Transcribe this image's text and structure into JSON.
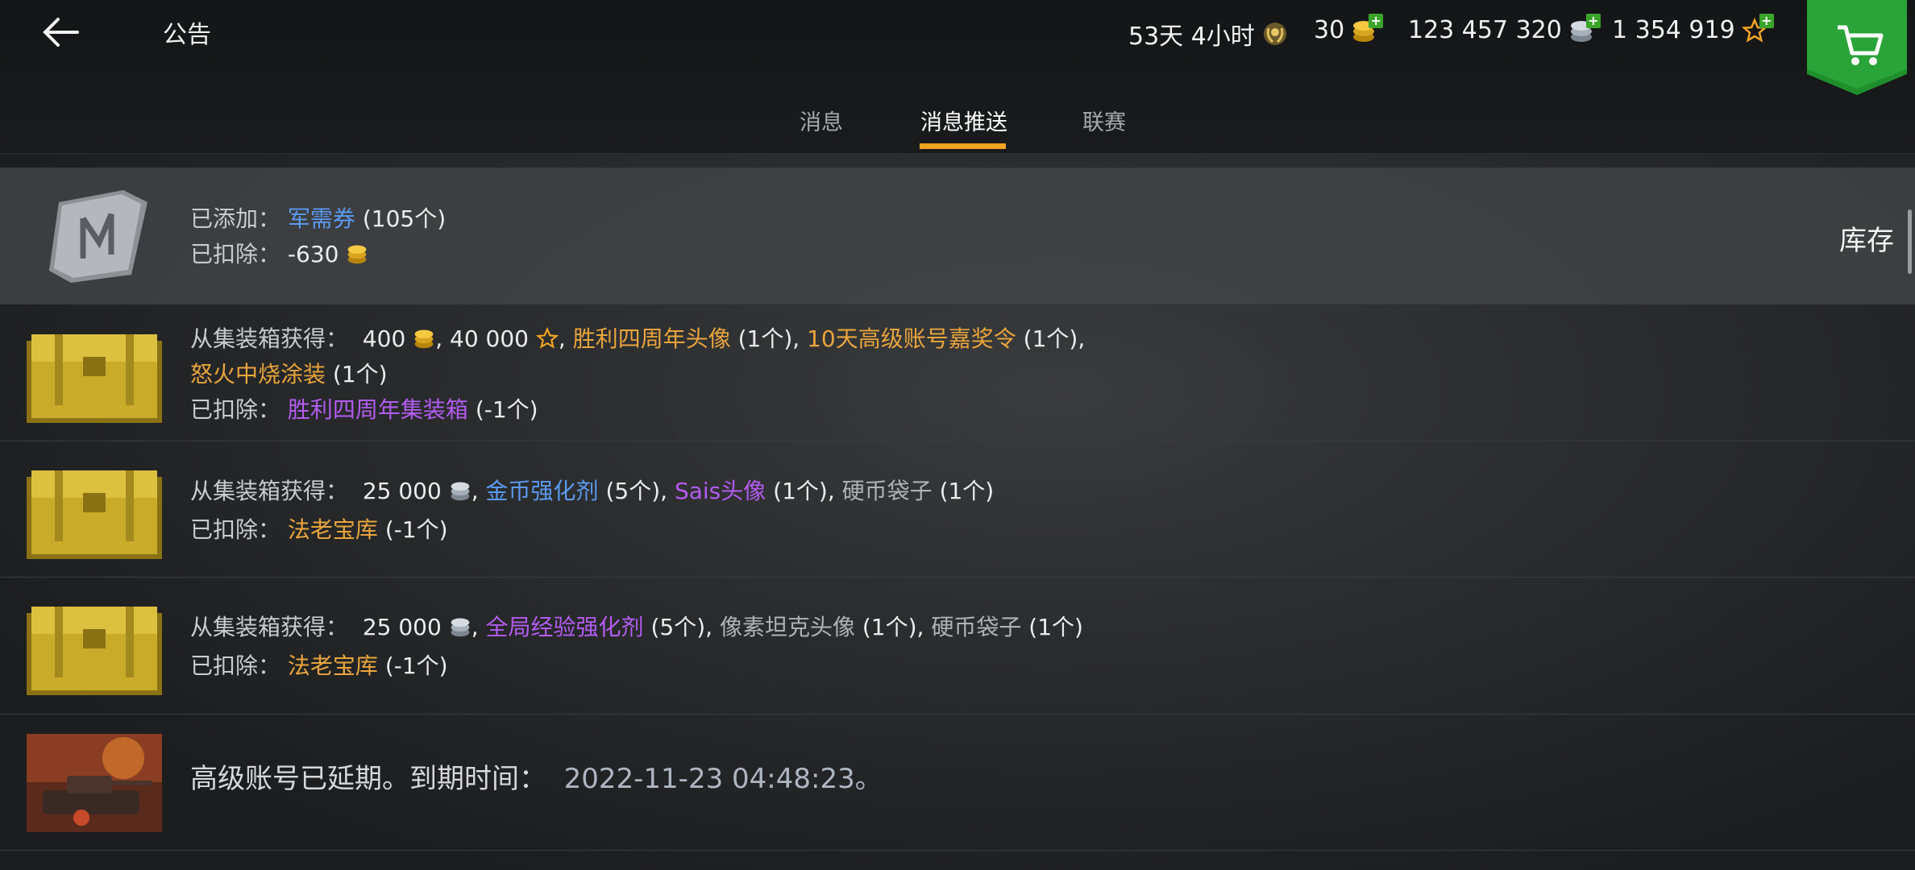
{
  "header": {
    "title": "公告",
    "currencies": {
      "premium_time": "53天 4小时",
      "gold": "30",
      "credits": "123 457 320",
      "free_xp": "1 354 919"
    }
  },
  "tabs": [
    {
      "label": "消息",
      "active": false
    },
    {
      "label": "消息推送",
      "active": true
    },
    {
      "label": "联赛",
      "active": false
    }
  ],
  "rows": [
    {
      "added_label": "已添加：",
      "added_item": "军需券",
      "added_count": "(105个)",
      "deducted_label": "已扣除：",
      "deducted_value": "-630",
      "side_action": "库存"
    },
    {
      "from_label": "从集装箱获得：",
      "gold": "400",
      "freexp": "40 000",
      "item1": "胜利四周年头像",
      "item1_count": "(1个)",
      "item2": "10天高级账号嘉奖令",
      "item2_count": "(1个)",
      "item3": "怒火中烧涂装",
      "item3_count": "(1个)",
      "deducted_label": "已扣除：",
      "deducted_item": "胜利四周年集装箱",
      "deducted_count": "(-1个)"
    },
    {
      "from_label": "从集装箱获得：",
      "credits": "25 000",
      "item1": "金币强化剂",
      "item1_count": "(5个)",
      "item2": "Sais头像",
      "item2_count": "(1个)",
      "item3": "硬币袋子",
      "item3_count": "(1个)",
      "deducted_label": "已扣除：",
      "deducted_item": "法老宝库",
      "deducted_count": "(-1个)"
    },
    {
      "from_label": "从集装箱获得：",
      "credits": "25 000",
      "item1": "全局经验强化剂",
      "item1_count": "(5个)",
      "item2": "像素坦克头像",
      "item2_count": "(1个)",
      "item3": "硬币袋子",
      "item3_count": "(1个)",
      "deducted_label": "已扣除：",
      "deducted_item": "法老宝库",
      "deducted_count": "(-1个)"
    },
    {
      "message": "高级账号已延期。到期时间：",
      "date": "2022-11-23 04:48:23。"
    }
  ],
  "icons": {
    "back": "back-arrow-icon",
    "premium": "premium-laurel-icon",
    "gold": "gold-coins-icon",
    "credits": "silver-coins-icon",
    "freexp": "star-icon",
    "shop": "shopping-cart-icon"
  },
  "colors": {
    "tab_indicator": "#f2a322",
    "plus_button": "#3aa52a",
    "shop_banner": "#1f8f2c",
    "rare_blue": "#5b9af0",
    "epic_purple": "#b35cf0",
    "legendary_orange": "#e9a53c"
  }
}
